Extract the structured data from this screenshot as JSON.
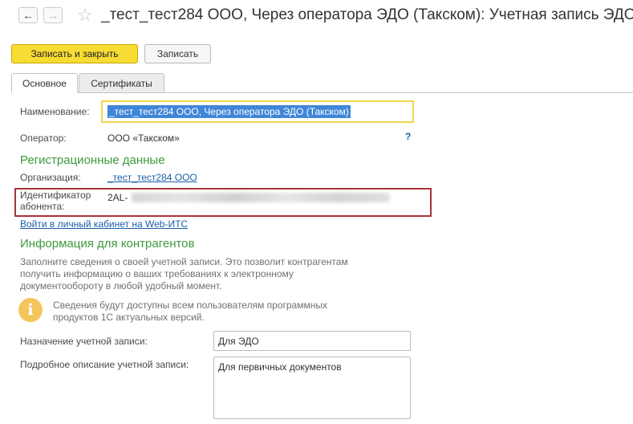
{
  "window": {
    "title": "_тест_тест284 ООО, Через оператора ЭДО (Такском): Учетная запись ЭДО"
  },
  "toolbar": {
    "save_close_label": "Записать и закрыть",
    "save_label": "Записать"
  },
  "tabs": [
    {
      "label": "Основное",
      "active": true
    },
    {
      "label": "Сертификаты",
      "active": false
    }
  ],
  "form": {
    "name_label": "Наименование:",
    "name_value": "_тест_тест284 ООО, Через оператора ЭДО (Такском)",
    "operator_label": "Оператор:",
    "operator_value": "ООО «Такском»",
    "help_symbol": "?"
  },
  "registration": {
    "heading": "Регистрационные данные",
    "org_label": "Организация:",
    "org_value": "_тест_тест284 ООО",
    "subscriber_label_line1": "Идентификатор",
    "subscriber_label_line2": "абонента:",
    "subscriber_value_prefix": "2AL-",
    "webits_link": "Войти в личный кабинет на Web-ИТС"
  },
  "counterparty_info": {
    "heading": "Информация для контрагентов",
    "description_lines": [
      "Заполните сведения о своей учетной записи. Это позволит контрагентам",
      "получить информацию о ваших требованиях к электронному",
      "документообороту в любой удобный момент."
    ],
    "note_lines": [
      "Сведения будут доступны всем пользователям программных",
      "продуктов 1С актуальных версий."
    ],
    "purpose_label": "Назначение учетной записи:",
    "purpose_value": "Для ЭДО",
    "details_label": "Подробное описание учетной записи:",
    "details_value": "Для первичных документов"
  },
  "colors": {
    "primary_button": "#f7dc33",
    "section_heading": "#3d9a3d",
    "link": "#1a5ea8",
    "highlight_border": "#a8323a",
    "selection": "#3f86d8"
  },
  "icons": [
    "back-arrow-icon",
    "forward-arrow-icon",
    "star-icon",
    "info-icon"
  ]
}
